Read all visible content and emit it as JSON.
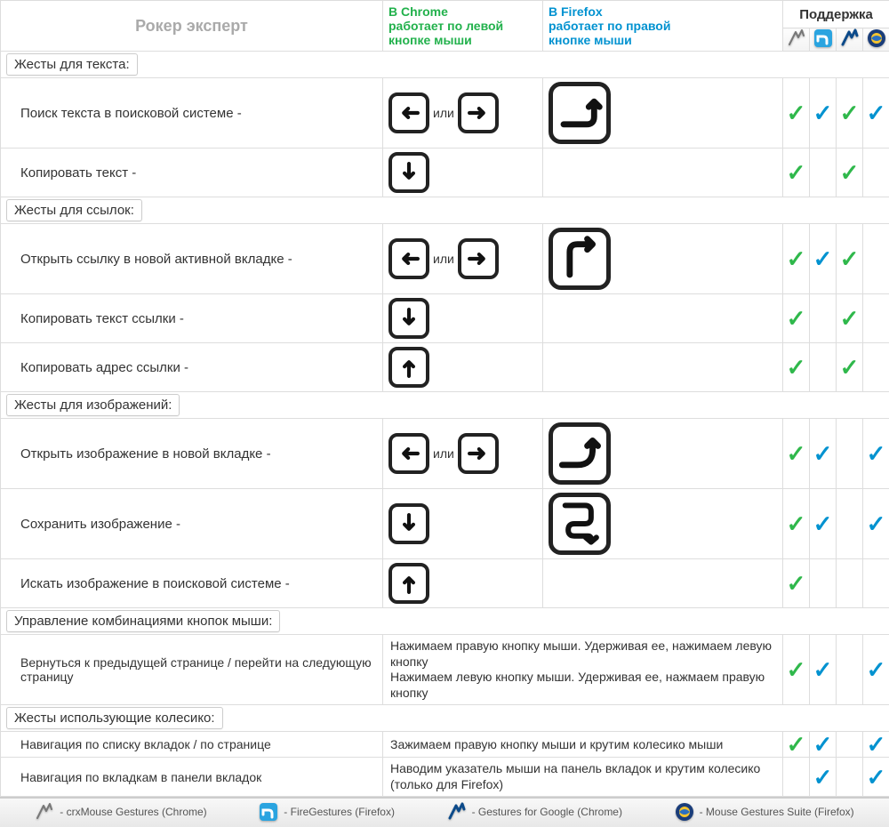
{
  "header": {
    "title": "Рокер эксперт",
    "chrome": "В Chrome\nработает по левой\nкнопке мыши",
    "firefox": "В Firefox\nработает по правой\nкнопке мыши",
    "support": "Поддержка"
  },
  "apps": [
    {
      "id": "crx",
      "name": "crxMouse Gestures (Chrome)"
    },
    {
      "id": "fire",
      "name": "FireGestures (Firefox)"
    },
    {
      "id": "gfg",
      "name": "Gestures for Google (Chrome)"
    },
    {
      "id": "mgs",
      "name": "Mouse Gestures Suite (Firefox)"
    }
  ],
  "or_label": "или",
  "legend_prefix": "- ",
  "sections": [
    {
      "title": "Жесты для текста:",
      "rows": [
        {
          "action": "Поиск текста в поисковой системе -",
          "chrome": "left-or-right",
          "firefox": "right-then-up",
          "support": [
            "g",
            "b",
            "g",
            "b"
          ]
        },
        {
          "action": "Копировать текст -",
          "chrome": "down",
          "firefox": "",
          "support": [
            "g",
            "",
            "g",
            ""
          ]
        }
      ]
    },
    {
      "title": "Жесты для ссылок:",
      "rows": [
        {
          "action": "Открыть ссылку в новой активной вкладке -",
          "chrome": "left-or-right",
          "firefox": "up-then-right",
          "support": [
            "g",
            "b",
            "g",
            ""
          ]
        },
        {
          "action": "Копировать текст ссылки -",
          "chrome": "down",
          "firefox": "",
          "support": [
            "g",
            "",
            "g",
            ""
          ]
        },
        {
          "action": "Копировать адрес ссылки -",
          "chrome": "up",
          "firefox": "",
          "support": [
            "g",
            "",
            "g",
            ""
          ]
        }
      ]
    },
    {
      "title": "Жесты для изображений:",
      "rows": [
        {
          "action": "Открыть изображение в новой вкладке -",
          "chrome": "left-or-right",
          "firefox": "right-then-up-arc",
          "support": [
            "g",
            "b",
            "",
            "b"
          ]
        },
        {
          "action": "Сохранить изображение -",
          "chrome": "down",
          "firefox": "down-right-down",
          "support": [
            "g",
            "b",
            "",
            "b"
          ]
        },
        {
          "action": "Искать изображение в поисковой системе -",
          "chrome": "up",
          "firefox": "",
          "support": [
            "g",
            "",
            "",
            ""
          ]
        }
      ]
    },
    {
      "title": "Управление комбинациями кнопок мыши:",
      "rows": [
        {
          "action": "Вернуться к предыдущей странице / перейти на следующую страницу",
          "instructions": "Нажимаем правую кнопку мыши. Удерживая ее, нажимаем левую кнопку\nНажимаем левую кнопку мыши. Удерживая ее, нажмаем правую кнопку",
          "support": [
            "g",
            "b",
            "",
            "b"
          ]
        }
      ]
    },
    {
      "title": "Жесты использующие колесико:",
      "rows": [
        {
          "action": "Навигация по списку вкладок / по странице",
          "instructions": "Зажимаем правую кнопку мыши и крутим колесико мыши",
          "support": [
            "g",
            "b",
            "",
            "b"
          ]
        },
        {
          "action": "Навигация по вкладкам в панели вкладок",
          "instructions": "Наводим указатель мыши на панель вкладок и крутим колесико (только для Firefox)",
          "support": [
            "",
            "b",
            "",
            "b"
          ]
        }
      ]
    }
  ]
}
